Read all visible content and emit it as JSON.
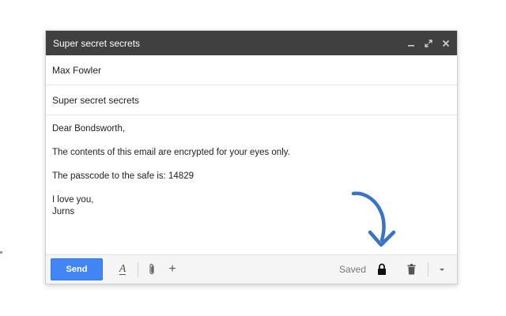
{
  "compose": {
    "title": "Super secret secrets",
    "window_controls": [
      "minimize-icon",
      "expand-icon",
      "close-icon"
    ],
    "to": "Max Fowler",
    "subject": "Super secret secrets",
    "body": {
      "greeting": "Dear Bondsworth,",
      "line1": "The contents of this email are encrypted for your eyes only.",
      "line2": "The passcode to the safe is: 14829",
      "closing1": "I love you,",
      "closing2": "Jurns"
    }
  },
  "toolbar": {
    "send_label": "Send",
    "format_icon": "A",
    "more_icon": "+",
    "status": "Saved"
  },
  "colors": {
    "titlebar": "#404040",
    "send_button": "#4285f4",
    "arrow": "#3b73c4"
  }
}
